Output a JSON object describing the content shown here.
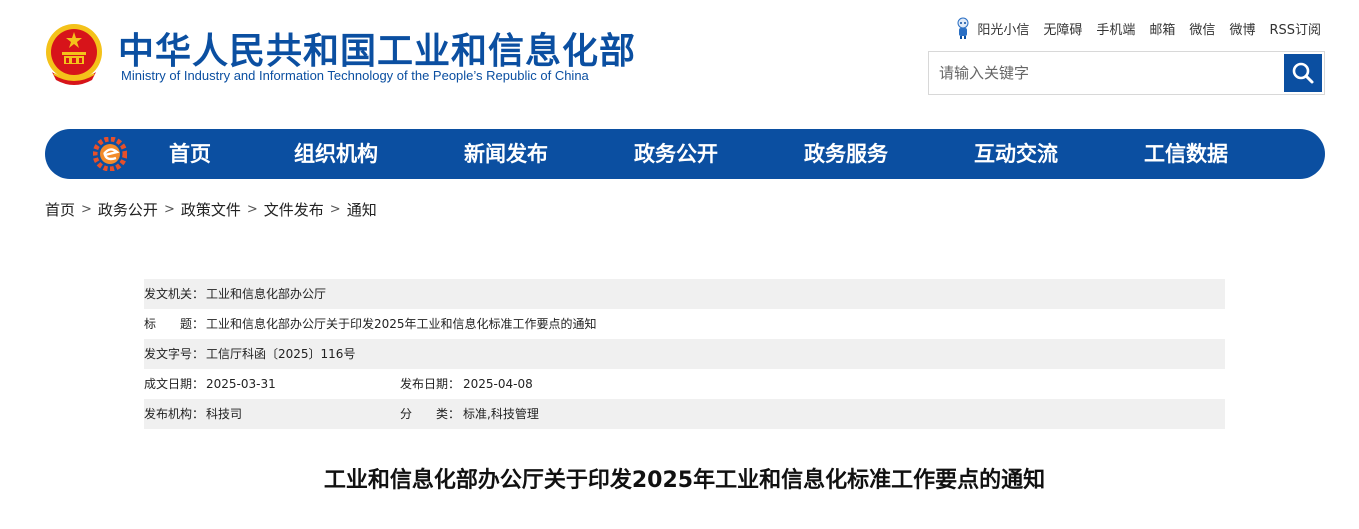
{
  "header": {
    "title": "中华人民共和国工业和信息化部",
    "subtitle": "Ministry of Industry and Information Technology of the People’s Republic of China"
  },
  "toplinks": [
    "阳光小信",
    "无障碍",
    "手机端",
    "邮箱",
    "微信",
    "微博",
    "RSS订阅"
  ],
  "search": {
    "placeholder": "请输入关键字"
  },
  "nav": [
    "首页",
    "组织机构",
    "新闻发布",
    "政务公开",
    "政务服务",
    "互动交流",
    "工信数据"
  ],
  "breadcrumb": [
    "首页",
    "政务公开",
    "政策文件",
    "文件发布",
    "通知"
  ],
  "breadcrumb_sep": ">",
  "info": {
    "issuer_label": "发文机关：",
    "issuer": "工业和信息化部办公厅",
    "title_label": "标　　题：",
    "title": "工业和信息化部办公厅关于印发2025年工业和信息化标准工作要点的通知",
    "docno_label": "发文字号：",
    "docno": "工信厅科函〔2025〕116号",
    "written_label": "成文日期：",
    "written": "2025-03-31",
    "published_label": "发布日期：",
    "published": "2025-04-08",
    "org_label": "发布机构：",
    "org": "科技司",
    "category_label": "分　　类：",
    "category": "标准,科技管理"
  },
  "article_title": "工业和信息化部办公厅关于印发2025年工业和信息化标准工作要点的通知",
  "colors": {
    "brand": "#0b4fa1",
    "row_shade": "#f0f0f0",
    "emblem_red": "#d7141a",
    "emblem_gold": "#f4c21a"
  },
  "icons": [
    "national-emblem",
    "robot-mascot-icon",
    "search-icon",
    "nav-logo-icon"
  ]
}
